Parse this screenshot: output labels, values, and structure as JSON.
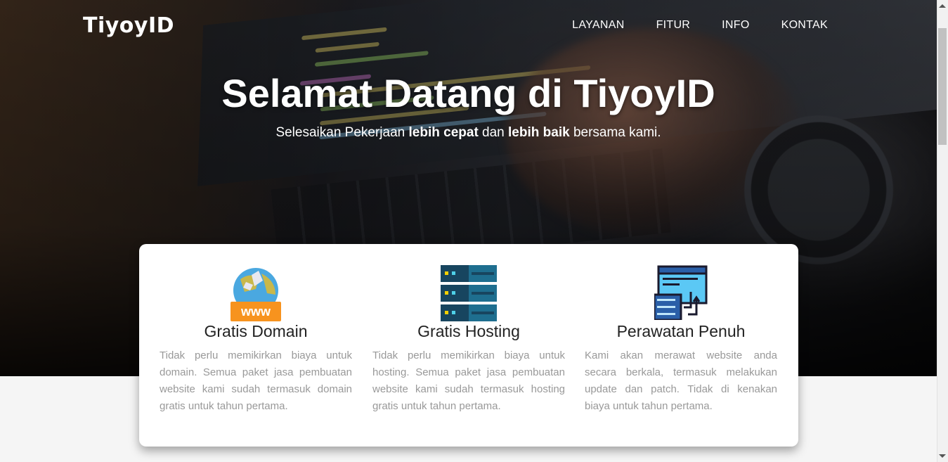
{
  "nav": {
    "brand": "TiyoyID",
    "items": [
      {
        "label": "LAYANAN"
      },
      {
        "label": "FITUR"
      },
      {
        "label": "INFO"
      },
      {
        "label": "KONTAK"
      }
    ]
  },
  "hero": {
    "title": "Selamat Datang di TiyoyID",
    "subtitle_parts": {
      "p1": "Selesaikan Pekerjaan ",
      "b1": "lebih cepat",
      "p2": " dan ",
      "b2": "lebih baik",
      "p3": " bersama kami."
    }
  },
  "features": [
    {
      "icon": "www-globe-icon",
      "icon_text": "www",
      "title": "Gratis Domain",
      "text": "Tidak perlu memikirkan biaya untuk domain. Semua paket jasa pembuatan website kami sudah termasuk domain gratis untuk tahun pertama."
    },
    {
      "icon": "server-rack-icon",
      "title": "Gratis Hosting",
      "text": "Tidak perlu memikirkan biaya untuk hosting. Semua paket jasa pembuatan website kami sudah termasuk hosting gratis untuk tahun pertama."
    },
    {
      "icon": "website-maintenance-icon",
      "title": "Perawatan Penuh",
      "text": "Kami akan merawat website anda secara berkala, termasuk melakukan update dan patch. Tidak di kenakan biaya untuk tahun pertama."
    }
  ],
  "colors": {
    "accent_orange": "#f7931e",
    "server_dark": "#17455f",
    "server_light": "#1e6e8f",
    "led_yellow": "#f5d000",
    "led_cyan": "#4fd1e8",
    "window_blue": "#5bc8f5"
  }
}
